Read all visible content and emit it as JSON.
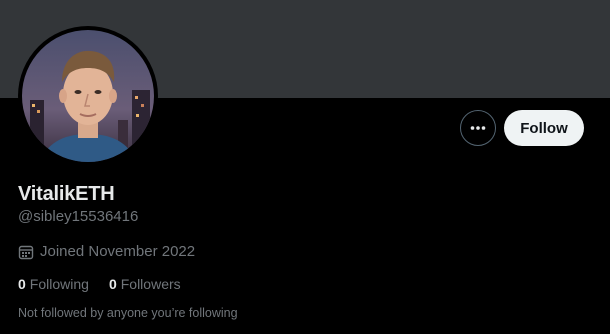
{
  "profile": {
    "display_name": "VitalikETH",
    "handle": "@sibley15536416",
    "joined": "Joined November 2022",
    "following_count": "0",
    "following_label": "Following",
    "followers_count": "0",
    "followers_label": "Followers",
    "followed_by_note": "Not followed by anyone you’re following"
  },
  "actions": {
    "follow_label": "Follow",
    "more_icon": "more-horizontal-icon"
  },
  "icons": {
    "joined": "calendar-icon"
  },
  "colors": {
    "background": "#000000",
    "banner": "#333639",
    "primary_text": "#e7e9ea",
    "secondary_text": "#71767b",
    "follow_button_bg": "#eff3f4"
  }
}
